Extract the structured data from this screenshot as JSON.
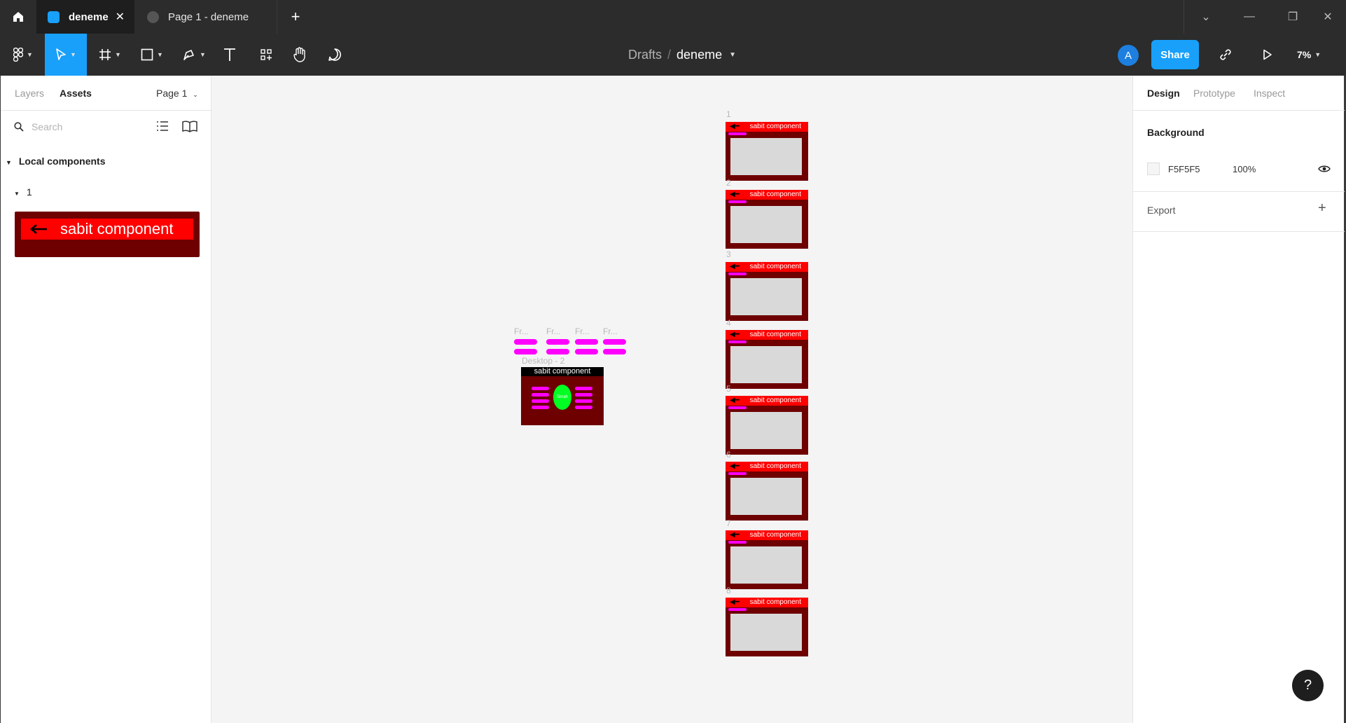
{
  "titlebar": {
    "tabs": [
      {
        "label": "deneme",
        "active": true
      },
      {
        "label": "Page 1 - deneme",
        "active": false
      }
    ]
  },
  "toolbar": {
    "breadcrumb": {
      "folder": "Drafts",
      "file": "deneme"
    },
    "avatar_initial": "A",
    "share_label": "Share",
    "zoom": "7%"
  },
  "left_panel": {
    "tabs": [
      "Layers",
      "Assets"
    ],
    "page_selector": "Page 1",
    "search_placeholder": "Search",
    "section_title": "Local components",
    "group_title": "1",
    "component_label": "sabit component"
  },
  "canvas": {
    "frames": [
      {
        "number": "1",
        "label": "sabit component"
      },
      {
        "number": "2",
        "label": "sabit component"
      },
      {
        "number": "3",
        "label": "sabit component"
      },
      {
        "number": "4",
        "label": "sabit component"
      },
      {
        "number": "5",
        "label": "sabit component"
      },
      {
        "number": "6",
        "label": "sabit component"
      },
      {
        "number": "7",
        "label": "sabit component"
      },
      {
        "number": "8",
        "label": "sabit component"
      }
    ],
    "mini_frames": [
      "Fr...",
      "Fr...",
      "Fr...",
      "Fr..."
    ],
    "desktop": {
      "label": "Desktop - 2",
      "bar_text": "sabit component",
      "oval_text": "Sirrah"
    }
  },
  "right_panel": {
    "tabs": [
      "Design",
      "Prototype",
      "Inspect"
    ],
    "background": {
      "title": "Background",
      "hex": "F5F5F5",
      "opacity": "100%"
    },
    "export_label": "Export"
  },
  "help_label": "?"
}
